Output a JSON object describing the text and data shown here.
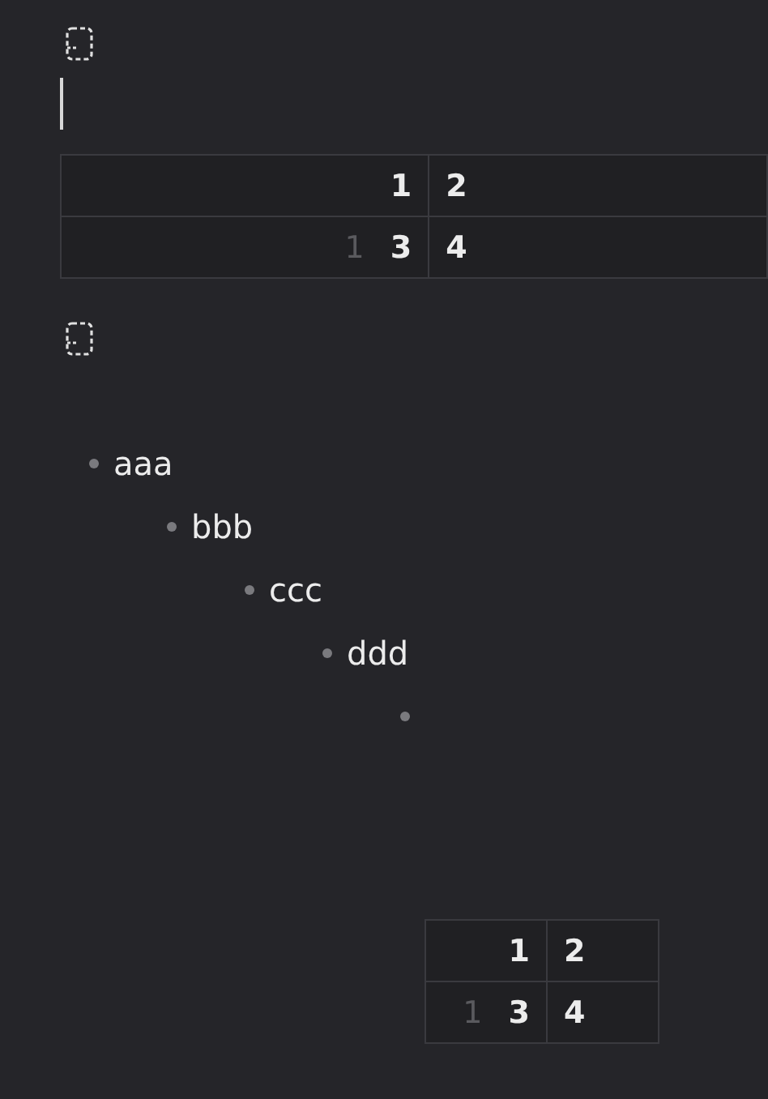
{
  "blocks": [
    {
      "kind": "placeholder_icon"
    },
    {
      "kind": "cursor"
    },
    {
      "kind": "table",
      "rows": [
        {
          "cells": [
            "1",
            "2"
          ]
        },
        {
          "row_number": "1",
          "cells": [
            "3",
            "4"
          ]
        }
      ]
    },
    {
      "kind": "placeholder_icon"
    },
    {
      "kind": "list",
      "items": [
        {
          "text": "aaa",
          "children": [
            {
              "text": "bbb",
              "children": [
                {
                  "text": "ccc",
                  "children": [
                    {
                      "text": "ddd",
                      "children": [
                        {
                          "table": {
                            "rows": [
                              {
                                "cells": [
                                  "1",
                                  "2"
                                ]
                              },
                              {
                                "row_number": "1",
                                "cells": [
                                  "3",
                                  "4"
                                ]
                              }
                            ]
                          }
                        }
                      ]
                    }
                  ]
                }
              ]
            }
          ]
        }
      ]
    }
  ]
}
